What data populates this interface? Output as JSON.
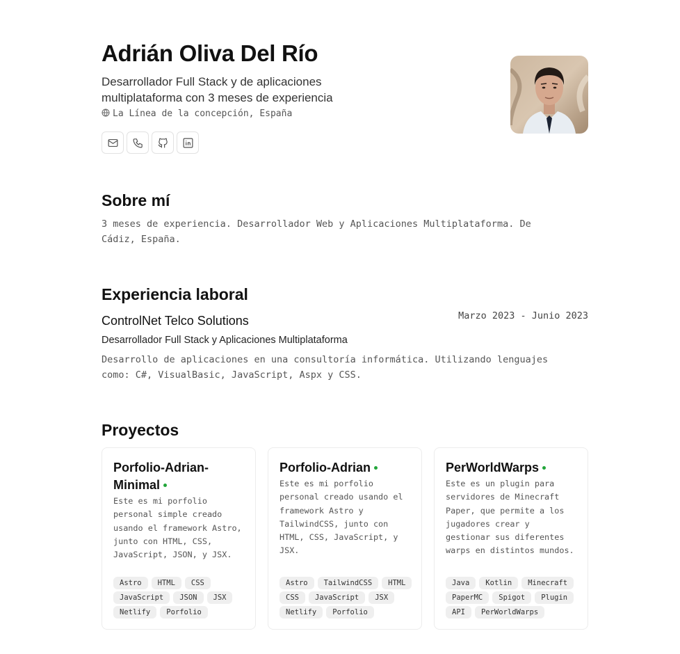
{
  "header": {
    "name": "Adrián Oliva Del Río",
    "tagline": "Desarrollador Full Stack y de aplicaciones multiplataforma con 3 meses de experiencia",
    "location": "La Línea de la concepción, España",
    "contacts": [
      {
        "icon": "mail-icon"
      },
      {
        "icon": "phone-icon"
      },
      {
        "icon": "github-icon"
      },
      {
        "icon": "linkedin-icon"
      }
    ]
  },
  "about": {
    "title": "Sobre mí",
    "text": "3 meses de experiencia. Desarrollador Web y Aplicaciones Multiplataforma. De Cádiz, España."
  },
  "experience": {
    "title": "Experiencia laboral",
    "items": [
      {
        "company": "ControlNet Telco Solutions",
        "dates": "Marzo 2023 - Junio 2023",
        "role": "Desarrollador Full Stack y Aplicaciones Multiplataforma",
        "description": "Desarrollo de aplicaciones en una consultoría informática. Utilizando lenguajes como: C#, VisualBasic, JavaScript, Aspx y CSS."
      }
    ]
  },
  "projects": {
    "title": "Proyectos",
    "items": [
      {
        "title": "Porfolio-Adrian-Minimal",
        "description": "Este es mi porfolio personal simple creado usando el framework Astro, junto con HTML, CSS, JavaScript, JSON, y JSX.",
        "tags": [
          "Astro",
          "HTML",
          "CSS",
          "JavaScript",
          "JSON",
          "JSX",
          "Netlify",
          "Porfolio"
        ]
      },
      {
        "title": "Porfolio-Adrian",
        "description": "Este es mi porfolio personal creado usando el framework Astro y TailwindCSS, junto con HTML, CSS, JavaScript, y JSX.",
        "tags": [
          "Astro",
          "TailwindCSS",
          "HTML",
          "CSS",
          "JavaScript",
          "JSX",
          "Netlify",
          "Porfolio"
        ]
      },
      {
        "title": "PerWorldWarps",
        "description": "Este es un plugin para servidores de Minecraft Paper, que permite a los jugadores crear y gestionar sus diferentes warps en distintos mundos.",
        "tags": [
          "Java",
          "Kotlin",
          "Minecraft",
          "PaperMC",
          "Spigot",
          "Plugin",
          "API",
          "PerWorldWarps"
        ]
      }
    ]
  },
  "colors": {
    "active_dot": "#22a53a",
    "tag_bg": "#efefef"
  }
}
